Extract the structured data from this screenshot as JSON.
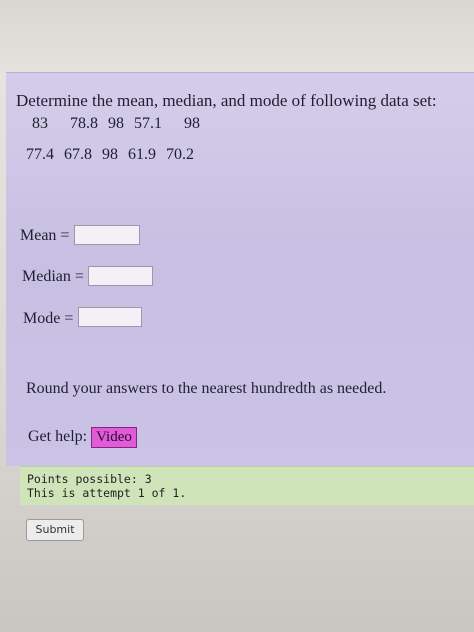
{
  "question": {
    "prompt": "Determine the mean, median, and mode of following data set:",
    "row1": [
      "83",
      "78.8",
      "98",
      "57.1",
      "98"
    ],
    "row2": [
      "77.4",
      "67.8",
      "98",
      "61.9",
      "70.2"
    ]
  },
  "answers": {
    "mean_label": "Mean =",
    "median_label": "Median =",
    "mode_label": "Mode =",
    "mean_value": "",
    "median_value": "",
    "mode_value": ""
  },
  "instructions": "Round your answers to the nearest hundredth as needed.",
  "help": {
    "label": "Get help:",
    "video_label": "Video"
  },
  "status": {
    "points": "Points possible: 3",
    "attempt": "This is attempt 1 of 1."
  },
  "submit_label": "Submit",
  "colors": {
    "panel": "#cbc3e6",
    "video_button": "#e25ad8",
    "points_panel": "#cfe4b9"
  }
}
